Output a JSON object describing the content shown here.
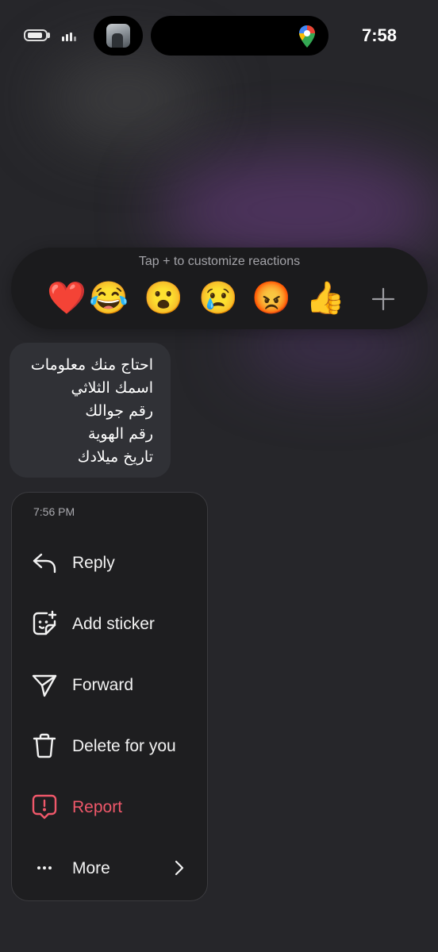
{
  "status_bar": {
    "time": "7:58"
  },
  "reaction_bar": {
    "hint": "Tap + to customize reactions",
    "reactions": [
      {
        "name": "heart",
        "glyph": "❤️"
      },
      {
        "name": "laughing-tears",
        "glyph": "😂"
      },
      {
        "name": "surprised",
        "glyph": "😮"
      },
      {
        "name": "crying",
        "glyph": "😢"
      },
      {
        "name": "angry",
        "glyph": "😡"
      },
      {
        "name": "thumbs-up",
        "glyph": "👍"
      }
    ],
    "add_icon": "plus-icon"
  },
  "message": {
    "lines": [
      "احتاج منك معلومات",
      "اسمك الثلاثي",
      "رقم جوالك",
      "رقم الهوية",
      "تاريخ ميلادك"
    ]
  },
  "context_menu": {
    "timestamp": "7:56 PM",
    "items": [
      {
        "label": "Reply",
        "icon": "reply-icon"
      },
      {
        "label": "Add sticker",
        "icon": "sticker-icon"
      },
      {
        "label": "Forward",
        "icon": "forward-icon"
      },
      {
        "label": "Delete for you",
        "icon": "trash-icon"
      },
      {
        "label": "Report",
        "icon": "report-icon",
        "color": "#f0586a"
      },
      {
        "label": "More",
        "icon": "more-icon"
      }
    ]
  }
}
